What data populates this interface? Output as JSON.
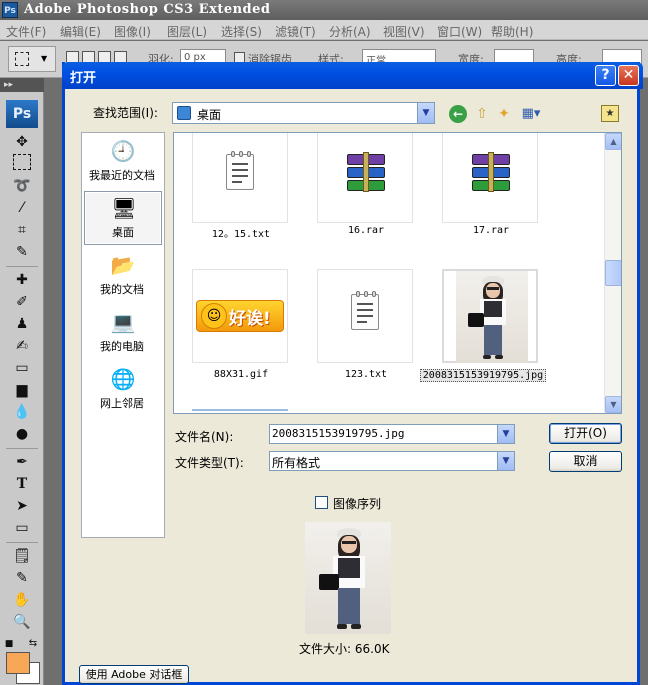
{
  "app": {
    "title": "Adobe Photoshop CS3 Extended",
    "icon_text": "Ps"
  },
  "menubar": {
    "items": [
      "文件(F)",
      "编辑(E)",
      "图像(I)",
      "图层(L)",
      "选择(S)",
      "滤镜(T)",
      "分析(A)",
      "视图(V)",
      "窗口(W)",
      "帮助(H)"
    ]
  },
  "options_bar": {
    "feather_label": "羽化:",
    "feather_value": "0 px",
    "antialias_label": "消除锯齿",
    "style_label": "样式:",
    "style_value": "正常",
    "width_label": "宽度:",
    "height_label": "高度:"
  },
  "tools_panel": {
    "header": "▸▸",
    "logo": "Ps",
    "foreground_color": "#f7a755",
    "background_color": "#ffffff"
  },
  "dialog": {
    "title": "打开",
    "help_label": "?",
    "close_label": "✕",
    "lookin_label": "查找范围(I):",
    "lookin_value": "桌面",
    "places": [
      {
        "label": "我最近的文档",
        "icon": "recent-documents-icon"
      },
      {
        "label": "桌面",
        "icon": "desktop-icon"
      },
      {
        "label": "我的文档",
        "icon": "my-documents-icon"
      },
      {
        "label": "我的电脑",
        "icon": "my-computer-icon"
      },
      {
        "label": "网上邻居",
        "icon": "network-places-icon"
      }
    ],
    "files": [
      {
        "name": "12。15.txt",
        "type": "txt"
      },
      {
        "name": "16.rar",
        "type": "rar"
      },
      {
        "name": "17.rar",
        "type": "rar"
      },
      {
        "name": "88X31.gif",
        "type": "gif",
        "banner_text": "好诶!"
      },
      {
        "name": "123.txt",
        "type": "txt"
      },
      {
        "name": "2008315153919795.jpg",
        "type": "jpg",
        "selected": true
      }
    ],
    "filename_label": "文件名(N):",
    "filename_value": "2008315153919795.jpg",
    "filetype_label": "文件类型(T):",
    "filetype_value": "所有格式",
    "open_label": "打开(O)",
    "cancel_label": "取消",
    "sequence_label": "图像序列",
    "filesize_label": "文件大小: 66.0K",
    "adobe_dialog_label": "使用 Adobe 对话框"
  }
}
